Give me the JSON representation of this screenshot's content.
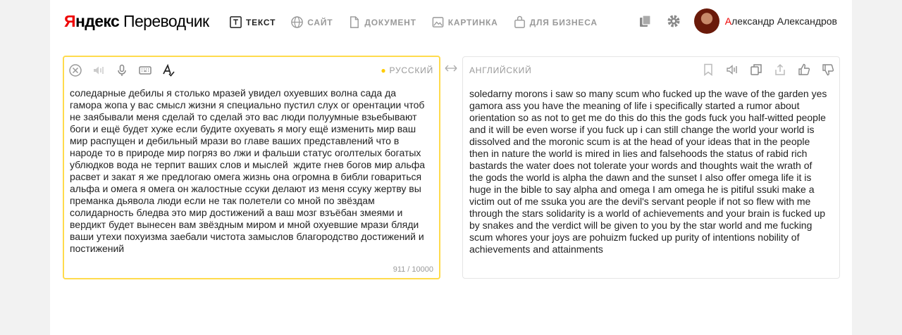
{
  "header": {
    "logo_ya": "Я",
    "logo_ndex": "ндекс",
    "logo_product": "Переводчик",
    "nav": [
      {
        "label": "ТЕКСТ",
        "icon": "text-icon",
        "active": true
      },
      {
        "label": "САЙТ",
        "icon": "globe-icon",
        "active": false
      },
      {
        "label": "ДОКУМЕНТ",
        "icon": "document-icon",
        "active": false
      },
      {
        "label": "КАРТИНКА",
        "icon": "image-icon",
        "active": false
      },
      {
        "label": "ДЛЯ БИЗНЕСА",
        "icon": "briefcase-icon",
        "active": false
      }
    ],
    "user_first_letter": "А",
    "user_rest": "лександр Александров"
  },
  "source": {
    "language": "РУССКИЙ",
    "text": "соледарные дебилы я столько мразей увидел охуевших волна сада да\nгамора жопа у вас смысл жизни я специально пустил слух ог орентации чтоб\nне заябывали меня сделай то сделай это вас люди полуумные взьебывают\nбоги и ещё будет хуже если будите охуевать я могу ещё изменить мир ваш\nмир распущен и дебильный мрази во главе ваших представлений что в\nнароде то в природе мир погряз во лжи и фальши статус оголтелых богатых\nублюдков вода не терпит ваших слов и мыслей  ждите гнев богов мир альфа\nрасвет и закат я же предлогаю омега жизнь она огромна в библи говариться\nальфа и омега я омега он жалостные ссуки делают из меня ссуку жертву вы\nпреманка дьявола люди если не так полетели со мной по звёздам\nсолидарность бледва это мир достижений а ваш мозг взъёбан змеями и\nвердикт будет вынесен вам звёздным миром и мной охуевшие мрази бляди\nваши утехи похуизма заебали чистота замыслов благородство достижений и\nпостижений",
    "counter": "911 / 10000"
  },
  "target": {
    "language": "АНГЛИЙСКИЙ",
    "text": "soledarny morons i saw so many scum who fucked up the wave of the garden yes\ngamora ass you have the meaning of life i specifically started a rumor about\norientation so as not to get me do this do this the gods fuck you half-witted people\nand it will be even worse if you fuck up i can still change the world your world is\ndissolved and the moronic scum is at the head of your ideas that in the people\nthen in nature the world is mired in lies and falsehoods the status of rabid rich\nbastards the water does not tolerate your words and thoughts wait the wrath of\nthe gods the world is alpha the dawn and the sunset I also offer omega life it is\nhuge in the bible to say alpha and omega I am omega he is pitiful ssuki make a\nvictim out of me ssuka you are the devil's servant people if not so flew with me\nthrough the stars solidarity is a world of achievements and your brain is fucked up\nby snakes and the verdict will be given to you by the star world and me fucking\nscum whores your joys are pohuizm fucked up purity of intentions nobility of\nachievements and attainments"
  },
  "colors": {
    "accent": "#ffdb4d",
    "brand_red": "#ee0000",
    "muted": "#999999"
  }
}
